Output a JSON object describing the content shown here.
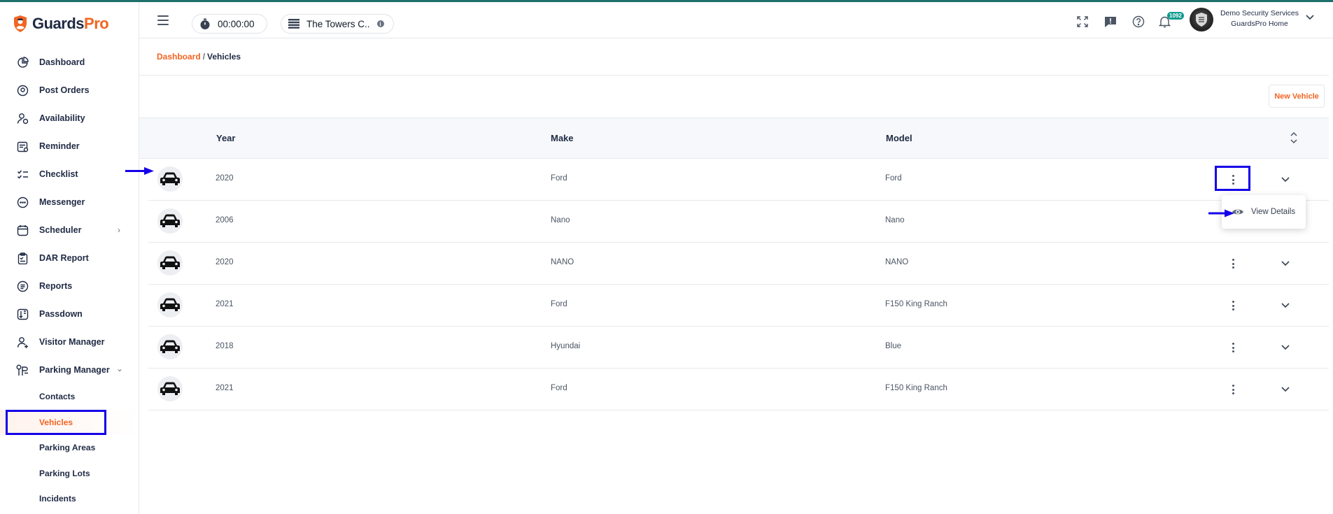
{
  "app": {
    "brand_main": "Guards",
    "brand_accent": "Pro",
    "accent_color": "#f26522",
    "highlight_color": "#1500e8"
  },
  "sidebar": {
    "items": [
      {
        "label": "Dashboard",
        "icon": "pie-chart-icon"
      },
      {
        "label": "Post Orders",
        "icon": "location-pin-icon"
      },
      {
        "label": "Availability",
        "icon": "user-clock-icon"
      },
      {
        "label": "Reminder",
        "icon": "calendar-reminder-icon"
      },
      {
        "label": "Checklist",
        "icon": "checklist-icon"
      },
      {
        "label": "Messenger",
        "icon": "chat-bubble-icon"
      },
      {
        "label": "Scheduler",
        "icon": "calendar-icon"
      },
      {
        "label": "DAR Report",
        "icon": "clipboard-icon"
      },
      {
        "label": "Reports",
        "icon": "document-icon"
      },
      {
        "label": "Passdown",
        "icon": "passdown-icon"
      },
      {
        "label": "Visitor Manager",
        "icon": "visitor-icon"
      },
      {
        "label": "Parking Manager",
        "icon": "parking-icon"
      }
    ],
    "parking_sub": [
      {
        "label": "Contacts"
      },
      {
        "label": "Vehicles"
      },
      {
        "label": "Parking Areas"
      },
      {
        "label": "Parking Lots"
      },
      {
        "label": "Incidents"
      }
    ]
  },
  "topbar": {
    "timer": "00:00:00",
    "site": "The Towers C..",
    "notification_count": "1092",
    "user_company": "Demo Security Services",
    "user_site": "GuardsPro Home"
  },
  "breadcrumb": {
    "home": "Dashboard",
    "separator": "/",
    "current": "Vehicles"
  },
  "actions": {
    "new_vehicle": "New Vehicle"
  },
  "table": {
    "headers": {
      "year": "Year",
      "make": "Make",
      "model": "Model"
    },
    "rows": [
      {
        "year": "2020",
        "make": "Ford",
        "model": "Ford"
      },
      {
        "year": "2006",
        "make": "Nano",
        "model": "Nano"
      },
      {
        "year": "2020",
        "make": "NANO",
        "model": "NANO"
      },
      {
        "year": "2021",
        "make": "Ford",
        "model": "F150 King Ranch"
      },
      {
        "year": "2018",
        "make": "Hyundai",
        "model": "Blue"
      },
      {
        "year": "2021",
        "make": "Ford",
        "model": "F150 King Ranch"
      }
    ]
  },
  "row_menu": {
    "view_details": "View Details"
  }
}
